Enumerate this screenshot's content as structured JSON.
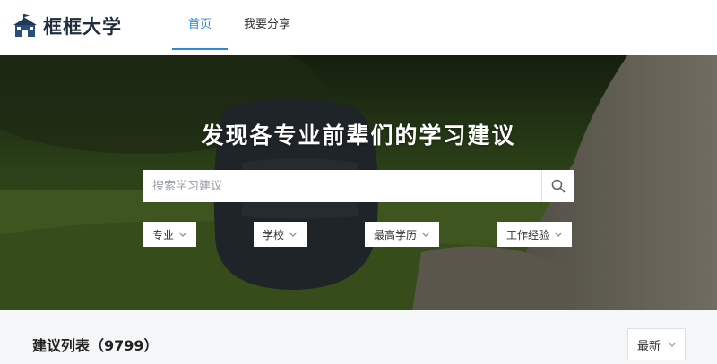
{
  "brand": {
    "name": "框框大学",
    "logo_icon": "school-building-icon"
  },
  "nav": {
    "items": [
      {
        "label": "首页",
        "active": true
      },
      {
        "label": "我要分享",
        "active": false
      }
    ],
    "accent_color": "#2b8ad8"
  },
  "hero": {
    "title": "发现各专业前辈们的学习建议",
    "search": {
      "placeholder": "搜索学习建议",
      "value": "",
      "icon": "search-icon"
    },
    "filters": [
      {
        "label": "专业",
        "icon": "chevron-down-icon"
      },
      {
        "label": "学校",
        "icon": "chevron-down-icon"
      },
      {
        "label": "最高学历",
        "icon": "chevron-down-icon"
      },
      {
        "label": "工作经验",
        "icon": "chevron-down-icon"
      }
    ]
  },
  "list": {
    "title": "建议列表（9799）",
    "sort": {
      "value": "最新",
      "icon": "chevron-down-icon"
    }
  }
}
